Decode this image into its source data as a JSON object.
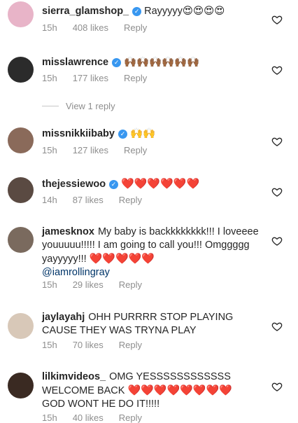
{
  "comments": [
    {
      "username": "sierra_glamshop_",
      "verified": true,
      "text": "Rayyyyy",
      "emoji": "😍😍😍😍",
      "time": "15h",
      "likes": "408 likes",
      "reply": "Reply",
      "avatar_color": "#e8b4c8"
    },
    {
      "username": "misslawrence",
      "verified": true,
      "text": "",
      "emoji": "🙌🏾🙌🏾🙌🏾🙌🏾🙌🏾🙌🏾",
      "time": "15h",
      "likes": "177 likes",
      "reply": "Reply",
      "avatar_color": "#2b2b2b"
    },
    {
      "username": "missnikkiibaby",
      "verified": true,
      "text": "",
      "emoji": "🙌🙌",
      "time": "15h",
      "likes": "127 likes",
      "reply": "Reply",
      "avatar_color": "#8a6a5a"
    },
    {
      "username": "thejessiewoo",
      "verified": true,
      "text": "",
      "emoji": "❤️❤️❤️❤️❤️❤️",
      "time": "14h",
      "likes": "87 likes",
      "reply": "Reply",
      "avatar_color": "#5a4a42"
    },
    {
      "username": "jamesknox",
      "verified": false,
      "text": "My baby is backkkkkkkk!!! I loveeee youuuuu!!!!! I am going to call you!!! Omggggg yayyyyy!!!",
      "emoji": "❤️❤️❤️❤️❤️",
      "mention": "@iamrollingray",
      "time": "15h",
      "likes": "29 likes",
      "reply": "Reply",
      "avatar_color": "#7a6a5e"
    },
    {
      "username": "jaylayahj",
      "verified": false,
      "text": "OHH PURRRR STOP PLAYING CAUSE THEY WAS TRYNA PLAY",
      "emoji": "",
      "time": "15h",
      "likes": "70 likes",
      "reply": "Reply",
      "avatar_color": "#d8c8b8"
    },
    {
      "username": "lilkimvideos_",
      "verified": false,
      "text": "OMG YESSSSSSSSSSSS WELCOME BACK",
      "emoji": "❤️❤️❤️❤️❤️❤️❤️❤️",
      "text2": "GOD WONT HE DO IT!!!!!",
      "time": "15h",
      "likes": "40 likes",
      "reply": "Reply",
      "avatar_color": "#3a2a22"
    }
  ],
  "view_replies_label": "View 1 reply",
  "colors": {
    "verified": "#3897f0",
    "meta": "#8e8e8e",
    "mention": "#003569",
    "heart": "#ed4956"
  }
}
